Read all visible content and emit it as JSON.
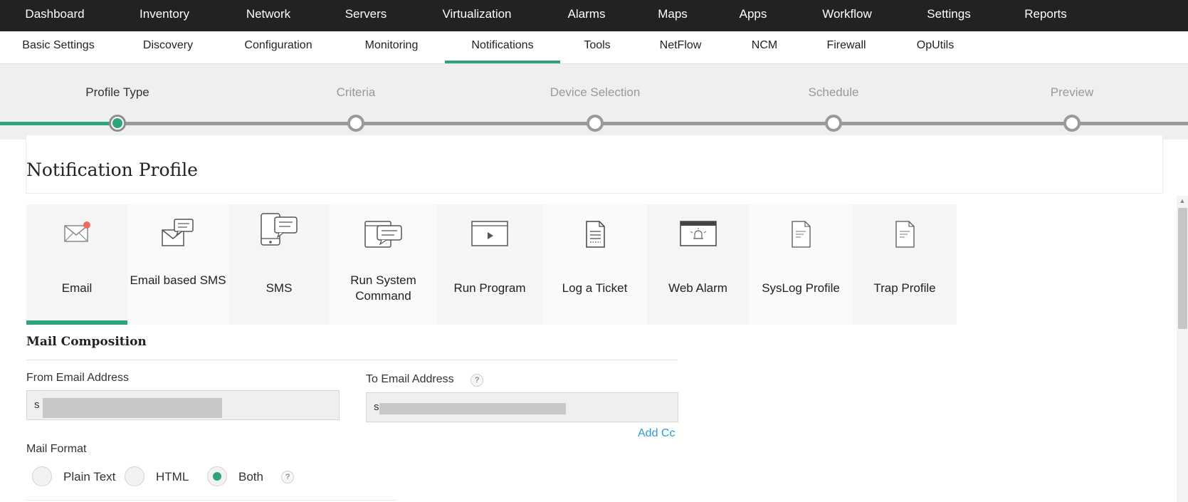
{
  "top_nav": [
    "Dashboard",
    "Inventory",
    "Network",
    "Servers",
    "Virtualization",
    "Alarms",
    "Maps",
    "Apps",
    "Workflow",
    "Settings",
    "Reports"
  ],
  "sub_nav": {
    "items": [
      "Basic Settings",
      "Discovery",
      "Configuration",
      "Monitoring",
      "Notifications",
      "Tools",
      "NetFlow",
      "NCM",
      "Firewall",
      "OpUtils"
    ],
    "active": "Notifications"
  },
  "stepper": {
    "steps": [
      "Profile Type",
      "Criteria",
      "Device Selection",
      "Schedule",
      "Preview"
    ],
    "active": "Profile Type"
  },
  "page": {
    "title": "Notification Profile"
  },
  "profile_types": [
    {
      "label": "Email",
      "icon": "email-icon"
    },
    {
      "label": "Email based SMS",
      "icon": "email-sms-icon"
    },
    {
      "label": "SMS",
      "icon": "sms-phone-icon"
    },
    {
      "label": "Run System Command",
      "icon": "system-command-icon"
    },
    {
      "label": "Run Program",
      "icon": "run-program-icon"
    },
    {
      "label": "Log a Ticket",
      "icon": "ticket-icon"
    },
    {
      "label": "Web Alarm",
      "icon": "web-alarm-icon"
    },
    {
      "label": "SysLog Profile",
      "icon": "syslog-document-icon"
    },
    {
      "label": "Trap Profile",
      "icon": "trap-document-icon"
    }
  ],
  "selected_profile_type": "Email",
  "mail_composition": {
    "section_title": "Mail Composition",
    "from_label": "From Email Address",
    "from_value": "s",
    "to_label": "To Email Address",
    "to_value": "s",
    "add_cc": "Add Cc",
    "mail_format_label": "Mail Format",
    "formats": [
      "Plain Text",
      "HTML",
      "Both"
    ],
    "selected_format": "Both",
    "help_glyph": "?"
  },
  "colors": {
    "accent": "#2fa37c",
    "topnav_bg": "#222222",
    "link": "#2a9fd6"
  }
}
